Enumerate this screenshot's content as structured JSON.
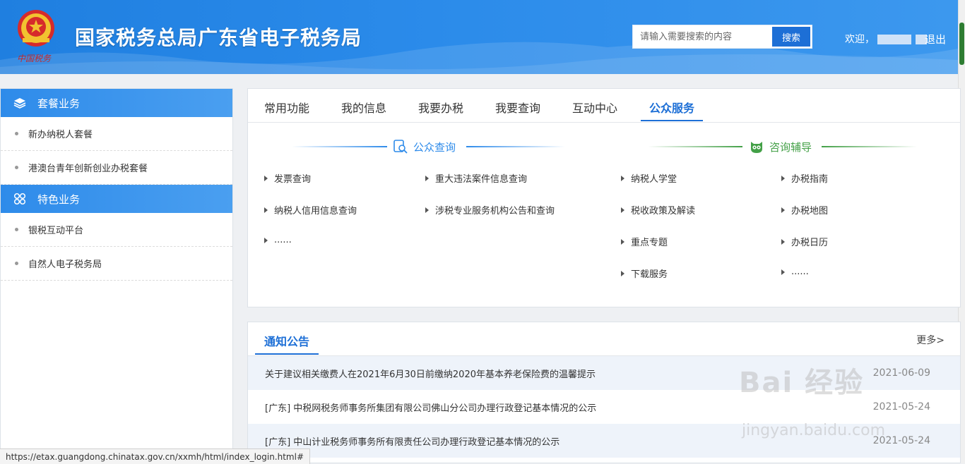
{
  "header": {
    "site_title": "国家税务总局广东省电子税务局",
    "search_placeholder": "请输入需要搜索的内容",
    "search_button": "搜索",
    "welcome": "欢迎，",
    "logout": "退出",
    "emblem_caption": "中国税务"
  },
  "sidebar": {
    "sections": [
      {
        "title": "套餐业务",
        "icon": "layers-icon",
        "items": [
          "新办纳税人套餐",
          "港澳台青年创新创业办税套餐"
        ]
      },
      {
        "title": "特色业务",
        "icon": "grid-icon",
        "items": [
          "银税互动平台",
          "自然人电子税务局"
        ]
      }
    ]
  },
  "tabs": [
    "常用功能",
    "我的信息",
    "我要办税",
    "我要查询",
    "互动中心",
    "公众服务"
  ],
  "active_tab": "公众服务",
  "public_query": {
    "title": "公众查询",
    "links": [
      "发票查询",
      "重大违法案件信息查询",
      "纳税人信用信息查询",
      "涉税专业服务机构公告和查询",
      "......"
    ]
  },
  "consult": {
    "title": "咨询辅导",
    "links": [
      "纳税人学堂",
      "办税指南",
      "税收政策及解读",
      "办税地图",
      "重点专题",
      "办税日历",
      "下载服务",
      "......"
    ]
  },
  "notice": {
    "title": "通知公告",
    "more": "更多>",
    "rows": [
      {
        "text": "关于建议相关缴费人在2021年6月30日前缴纳2020年基本养老保险费的温馨提示",
        "date": "2021-06-09"
      },
      {
        "text": "[广东] 中税网税务师事务所集团有限公司佛山分公司办理行政登记基本情况的公示",
        "date": "2021-05-24"
      },
      {
        "text": "[广东] 中山计业税务师事务所有限责任公司办理行政登记基本情况的公示",
        "date": "2021-05-24"
      }
    ]
  },
  "status_url": "https://etax.guangdong.chinatax.gov.cn/xxmh/html/index_login.html#",
  "watermark": {
    "main": "Bai 经验",
    "sub": "jingyan.baidu.com"
  },
  "colors": {
    "header_blue": "#2b8bea",
    "accent_blue": "#1d6fd6",
    "green": "#43a047"
  }
}
